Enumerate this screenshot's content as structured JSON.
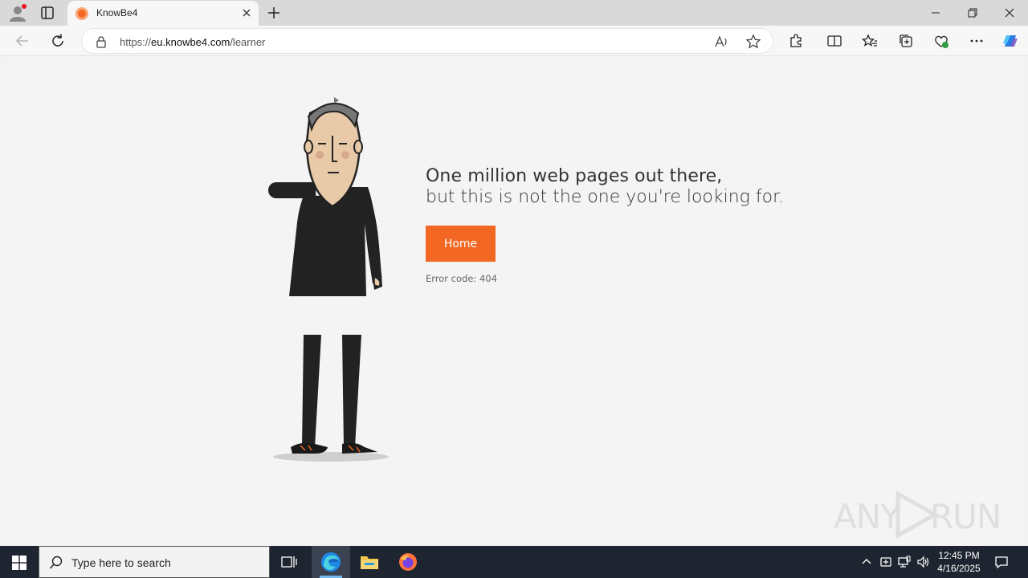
{
  "browser": {
    "tab_title": "KnowBe4",
    "url_domain_prefix": "https://",
    "url_domain": "eu.knowbe4.com",
    "url_path": "/learner"
  },
  "page": {
    "headline_line1": "One million web pages out there,",
    "headline_line2": "but this is not the one you're looking for.",
    "home_button": "Home",
    "error_code": "Error code: 404"
  },
  "watermark": {
    "left": "ANY",
    "right": "RUN"
  },
  "taskbar": {
    "search_placeholder": "Type here to search",
    "time": "12:45 PM",
    "date": "4/16/2025"
  },
  "colors": {
    "accent": "#f26722",
    "taskbar": "#1f2530"
  }
}
